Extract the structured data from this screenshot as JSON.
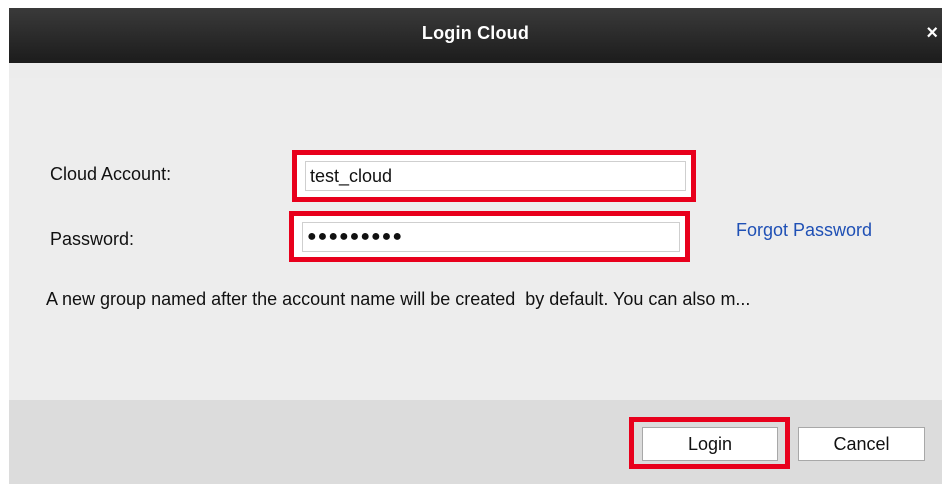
{
  "dialog": {
    "title": "Login Cloud",
    "close_glyph": "×"
  },
  "form": {
    "account_label": "Cloud Account:",
    "account_value": "test_cloud",
    "password_label": "Password:",
    "password_value": "●●●●●●●●●",
    "forgot_link": "Forgot Password",
    "note": "A new group named after the account name will be created  by default. You can also m..."
  },
  "buttons": {
    "login": "Login",
    "cancel": "Cancel"
  },
  "colors": {
    "highlight": "#e8001c",
    "link": "#1f50b5",
    "titlebar": "#1c1c1c"
  }
}
